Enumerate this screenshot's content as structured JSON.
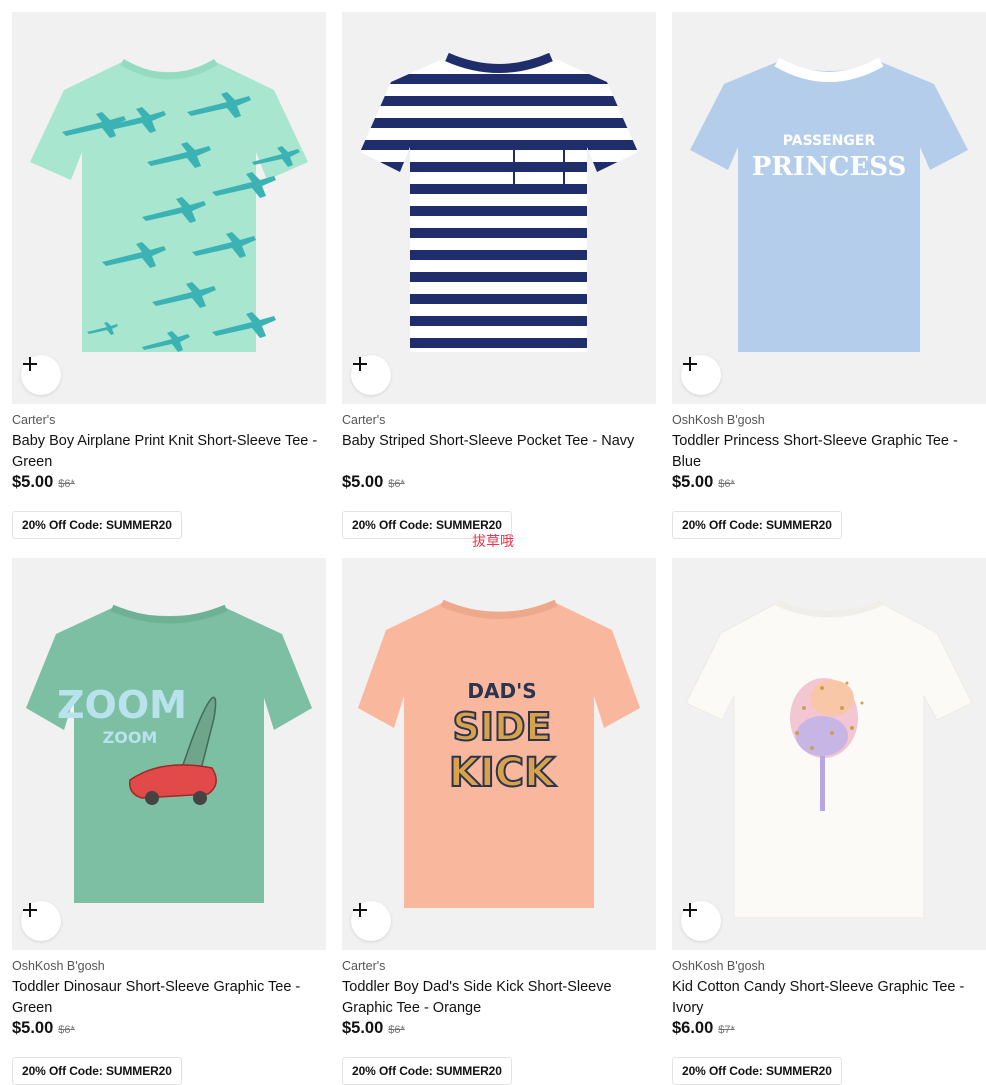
{
  "products": [
    {
      "brand": "Carter's",
      "title": "Baby Boy Airplane Print Knit Short-Sleeve Tee - Green",
      "price": "$5.00",
      "was": "$6*",
      "promo": "20% Off Code: SUMMER20",
      "image": "airplane-tee",
      "color": "#a8e6cf"
    },
    {
      "brand": "Carter's",
      "title": "Baby Striped Short-Sleeve Pocket Tee - Navy",
      "price": "$5.00",
      "was": "$6*",
      "promo": "20% Off Code: SUMMER20",
      "image": "striped-tee",
      "color": "#1f2d6b"
    },
    {
      "brand": "OshKosh B'gosh",
      "title": "Toddler Princess Short-Sleeve Graphic Tee - Blue",
      "price": "$5.00",
      "was": "$6*",
      "promo": "20% Off Code: SUMMER20",
      "image": "princess-tee",
      "color": "#b4cdeb",
      "graphic_text": [
        "PASSENGER",
        "PRINCESS"
      ]
    },
    {
      "brand": "OshKosh B'gosh",
      "title": "Toddler Dinosaur Short-Sleeve Graphic Tee - Green",
      "price": "$5.00",
      "was": "$6*",
      "promo": "20% Off Code: SUMMER20",
      "image": "dinosaur-tee",
      "color": "#7cbfa3",
      "graphic_text": [
        "ZOOM",
        "ZOOM"
      ]
    },
    {
      "brand": "Carter's",
      "title": "Toddler Boy Dad's Side Kick Short-Sleeve Graphic Tee - Orange",
      "price": "$5.00",
      "was": "$6*",
      "promo": "20% Off Code: SUMMER20",
      "image": "sidekick-tee",
      "color": "#f9b89e",
      "graphic_text": [
        "DAD'S",
        "SIDE",
        "KICK"
      ]
    },
    {
      "brand": "OshKosh B'gosh",
      "title": "Kid Cotton Candy Short-Sleeve Graphic Tee - Ivory",
      "price": "$6.00",
      "was": "$7*",
      "promo": "20% Off Code: SUMMER20",
      "image": "cotton-candy-tee",
      "color": "#fbfaf6"
    }
  ],
  "watermark": "拔草哦",
  "add_icon": "plus-icon"
}
